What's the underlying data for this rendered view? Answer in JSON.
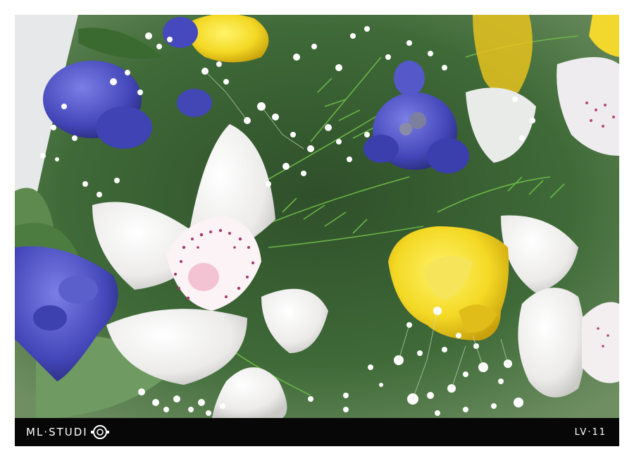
{
  "watermark": {
    "brand_text": "ML·STUDI",
    "edition_text": "LV·11"
  },
  "palette": {
    "frame": "#ffffff",
    "caption_bar": "#070707",
    "caption_text": "#ffffff",
    "foliage": "#3d6b35",
    "orchid": "#f2f2f0",
    "tulip": "#f5e03a",
    "hyacinth": "#4a4fc0",
    "gypsophila": "#ffffff"
  },
  "photo_subject": {
    "icons": [
      "white-orchid",
      "yellow-tulip",
      "blue-hyacinth",
      "baby-breath",
      "fern-foliage"
    ]
  }
}
